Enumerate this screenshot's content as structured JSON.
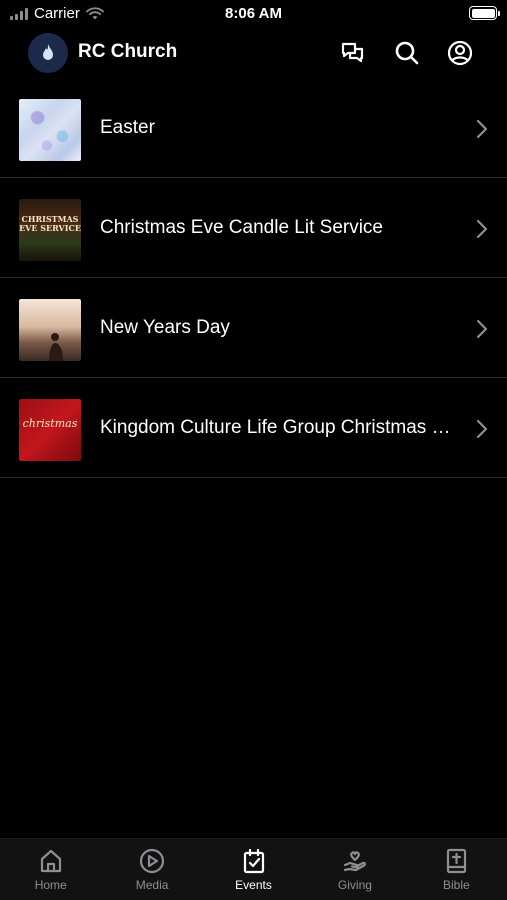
{
  "status_bar": {
    "carrier": "Carrier",
    "time": "8:06 AM"
  },
  "header": {
    "title": "RC Church",
    "icons": [
      "chat-icon",
      "search-icon",
      "account-icon"
    ]
  },
  "events": [
    {
      "label": "Easter",
      "thumbnail": "easter-thumbnail"
    },
    {
      "label": "Christmas Eve Candle Lit Service",
      "thumbnail": "christmas-eve-thumbnail",
      "thumbnail_text": "CHRISTMAS EVE SERVICE"
    },
    {
      "label": "New Years Day",
      "thumbnail": "new-years-thumbnail"
    },
    {
      "label": "Kingdom Culture Life Group Christmas Party",
      "thumbnail": "kingdom-culture-thumbnail",
      "thumbnail_text": "christmas"
    }
  ],
  "tab_bar": {
    "active": "Events",
    "tabs": [
      {
        "label": "Home",
        "icon": "home-icon"
      },
      {
        "label": "Media",
        "icon": "play-icon"
      },
      {
        "label": "Events",
        "icon": "calendar-check-icon"
      },
      {
        "label": "Giving",
        "icon": "giving-hand-icon"
      },
      {
        "label": "Bible",
        "icon": "bible-icon"
      }
    ]
  },
  "colors": {
    "background": "#000000",
    "text": "#ffffff",
    "inactive_tab": "#8e8e93",
    "divider": "#2c2c2e"
  }
}
